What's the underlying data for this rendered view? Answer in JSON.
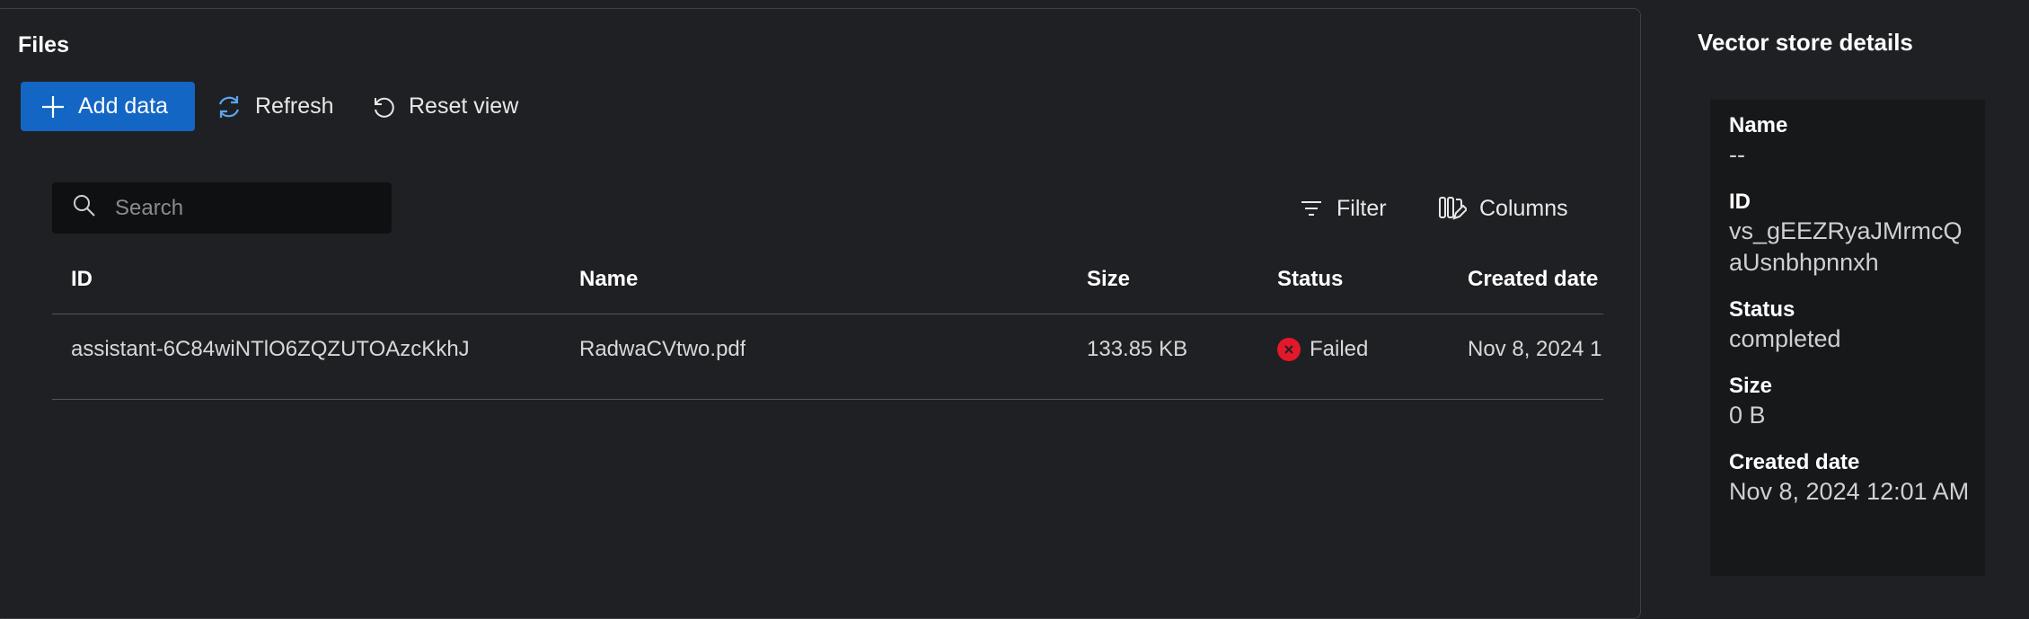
{
  "files": {
    "title": "Files",
    "toolbar": {
      "add_label": "Add data",
      "refresh_label": "Refresh",
      "reset_label": "Reset view"
    },
    "search": {
      "placeholder": "Search",
      "value": ""
    },
    "filter_label": "Filter",
    "columns_label": "Columns",
    "table": {
      "headers": [
        "ID",
        "Name",
        "Size",
        "Status",
        "Created date"
      ],
      "rows": [
        {
          "id": "assistant-6C84wiNTlO6ZQZUTOAzcKkhJ",
          "name": "RadwaCVtwo.pdf",
          "size": "133.85 KB",
          "status": "Failed",
          "created": "Nov 8, 2024 1"
        }
      ]
    }
  },
  "details": {
    "title": "Vector store details",
    "fields": [
      {
        "label": "Name",
        "value": "--"
      },
      {
        "label": "ID",
        "value": "vs_gEEZRyaJMrmcQaUsnbhpnnxh"
      },
      {
        "label": "Status",
        "value": "completed"
      },
      {
        "label": "Size",
        "value": "0 B"
      },
      {
        "label": "Created date",
        "value": "Nov 8, 2024 12:01 AM"
      }
    ]
  },
  "colors": {
    "background": "#1f2023",
    "accent": "#1366c4",
    "error": "#e3182b",
    "card": "#17181a"
  }
}
